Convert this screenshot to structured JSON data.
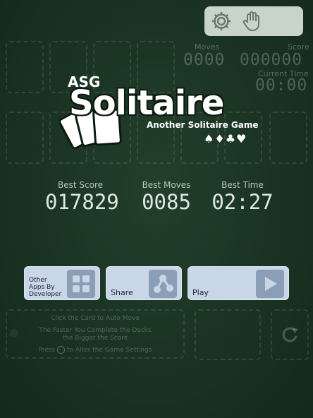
{
  "toolbar": {
    "settings_icon": "gear-icon",
    "hand_icon": "hand-icon"
  },
  "stats": {
    "moves_label": "Moves",
    "moves_value": "0000",
    "score_label": "Score",
    "score_value": "000000",
    "time_label": "Current Time",
    "time_value": "00:00"
  },
  "logo": {
    "asg": "ASG",
    "title": "Solitaire",
    "subtitle": "Another Solitaire Game",
    "suits": "♠♦♣♥"
  },
  "best": {
    "score_label": "Best Score",
    "score_value": "017829",
    "moves_label": "Best Moves",
    "moves_value": "0085",
    "time_label": "Best Time",
    "time_value": "02:27"
  },
  "menu": {
    "other_apps_line1": "Other",
    "other_apps_line2": "Apps By",
    "other_apps_line3": "Developer",
    "share_label": "Share",
    "play_label": "Play"
  },
  "hints": {
    "line1": "Click the Card to Auto Move",
    "line2": "The Faster You Complete the Decks",
    "line3": "the Bigger the Score",
    "line4_pre": "Press",
    "line4_post": "to Alter the Game Settings"
  },
  "colors": {
    "background": "#1a3322",
    "button": "#c9d6e6",
    "button_icon": "#8a9fb6",
    "toolbar": "#c9d4c9"
  }
}
